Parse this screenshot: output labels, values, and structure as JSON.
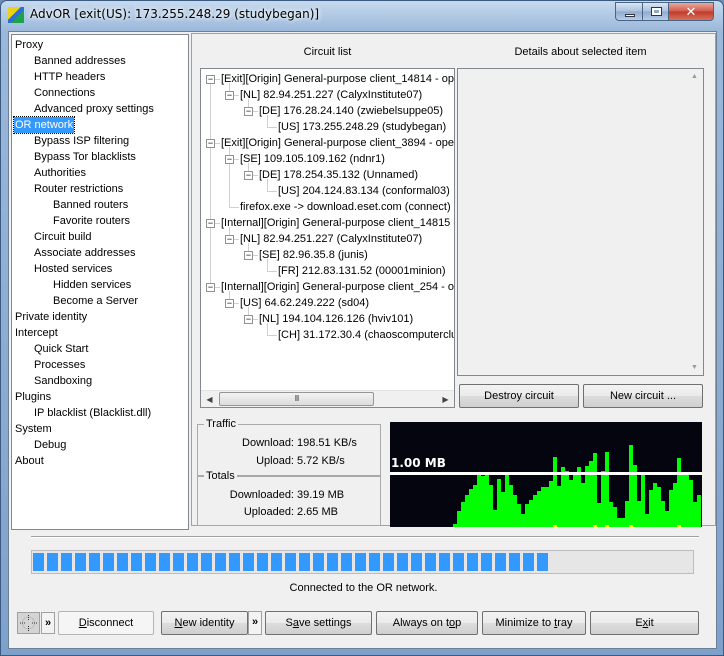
{
  "window": {
    "title": "AdvOR [exit(US): 173.255.248.29 (studybegan)]",
    "controls": {
      "minimize": "minimize",
      "maximize": "maximize",
      "close": "close"
    }
  },
  "nav": {
    "items": [
      {
        "label": "Proxy",
        "level": 0
      },
      {
        "label": "Banned addresses",
        "level": 1
      },
      {
        "label": "HTTP headers",
        "level": 1
      },
      {
        "label": "Connections",
        "level": 1
      },
      {
        "label": "Advanced proxy settings",
        "level": 1
      },
      {
        "label": "OR network",
        "level": 0,
        "selected": true
      },
      {
        "label": "Bypass ISP filtering",
        "level": 1
      },
      {
        "label": "Bypass Tor blacklists",
        "level": 1
      },
      {
        "label": "Authorities",
        "level": 1
      },
      {
        "label": "Router restrictions",
        "level": 1
      },
      {
        "label": "Banned routers",
        "level": 2
      },
      {
        "label": "Favorite routers",
        "level": 2
      },
      {
        "label": "Circuit build",
        "level": 1
      },
      {
        "label": "Associate addresses",
        "level": 1
      },
      {
        "label": "Hosted services",
        "level": 1
      },
      {
        "label": "Hidden services",
        "level": 2
      },
      {
        "label": "Become a Server",
        "level": 2
      },
      {
        "label": "Private identity",
        "level": 0
      },
      {
        "label": "Intercept",
        "level": 0
      },
      {
        "label": "Quick Start",
        "level": 1
      },
      {
        "label": "Processes",
        "level": 1
      },
      {
        "label": "Sandboxing",
        "level": 1
      },
      {
        "label": "Plugins",
        "level": 0
      },
      {
        "label": "IP blacklist (Blacklist.dll)",
        "level": 1
      },
      {
        "label": "System",
        "level": 0
      },
      {
        "label": "Debug",
        "level": 1
      },
      {
        "label": "About",
        "level": 0
      }
    ]
  },
  "circuits": {
    "header": "Circuit list",
    "rows": [
      {
        "label": "[Exit][Origin] General-purpose client_14814 - ope",
        "level": 0,
        "expander": "minus"
      },
      {
        "label": "[NL] 82.94.251.227 (CalyxInstitute07)",
        "level": 1,
        "expander": "minus"
      },
      {
        "label": "[DE] 176.28.24.140 (zwiebelsuppe05)",
        "level": 2,
        "expander": "minus"
      },
      {
        "label": "[US] 173.255.248.29 (studybegan)",
        "level": 3,
        "expander": "none"
      },
      {
        "label": "[Exit][Origin] General-purpose client_3894 - oper",
        "level": 0,
        "expander": "minus"
      },
      {
        "label": "[SE] 109.105.109.162 (ndnr1)",
        "level": 1,
        "expander": "minus"
      },
      {
        "label": "[DE] 178.254.35.132 (Unnamed)",
        "level": 2,
        "expander": "minus"
      },
      {
        "label": "[US] 204.124.83.134 (conformal03)",
        "level": 3,
        "expander": "none"
      },
      {
        "label": "firefox.exe -> download.eset.com (connect)",
        "level": 1,
        "expander": "none"
      },
      {
        "label": "[Internal][Origin] General-purpose client_14815 -",
        "level": 0,
        "expander": "minus"
      },
      {
        "label": "[NL] 82.94.251.227 (CalyxInstitute07)",
        "level": 1,
        "expander": "minus"
      },
      {
        "label": "[SE] 82.96.35.8 (junis)",
        "level": 2,
        "expander": "minus"
      },
      {
        "label": "[FR] 212.83.131.52 (00001minion)",
        "level": 3,
        "expander": "none"
      },
      {
        "label": "[Internal][Origin] General-purpose client_254 - op",
        "level": 0,
        "expander": "minus"
      },
      {
        "label": "[US] 64.62.249.222 (sd04)",
        "level": 1,
        "expander": "minus"
      },
      {
        "label": "[NL] 194.104.126.126 (hviv101)",
        "level": 2,
        "expander": "minus"
      },
      {
        "label": "[CH] 31.172.30.4 (chaoscomputerclu",
        "level": 3,
        "expander": "none"
      }
    ],
    "scroll_thumb": "III"
  },
  "details": {
    "header": "Details about selected item",
    "text": ""
  },
  "buttons": {
    "destroy_circuit": "Destroy circuit",
    "new_circuit": "New circuit ...",
    "disconnect": {
      "pre": "",
      "u": "D",
      "post": "isconnect"
    },
    "new_identity": {
      "pre": "",
      "u": "N",
      "post": "ew identity"
    },
    "save_settings": {
      "pre": "S",
      "u": "a",
      "post": "ve settings"
    },
    "always_on_top": {
      "pre": "Always on t",
      "u": "o",
      "post": "p"
    },
    "minimize_to_tray": {
      "pre": "Minimize to ",
      "u": "t",
      "post": "ray"
    },
    "exit": {
      "pre": "E",
      "u": "x",
      "post": "it"
    },
    "more": "»"
  },
  "traffic": {
    "title": "Traffic",
    "download_label": "Download:",
    "download_value": "198.51 KB/s",
    "upload_label": "Upload:",
    "upload_value": "5.72 KB/s"
  },
  "totals": {
    "title": "Totals",
    "downloaded_label": "Downloaded:",
    "downloaded_value": "39.19 MB",
    "uploaded_label": "Uploaded:",
    "uploaded_value": "2.65 MB"
  },
  "graph": {
    "scale_label": "1.00 MB",
    "scale_value_mb": 1.0,
    "max_mb": 1.98,
    "colors": {
      "download": "#00ff00",
      "upload": "#ffff00",
      "background": "#050510",
      "scale_line": "#ffffff"
    },
    "download_mb": [
      0.05,
      0.3,
      0.47,
      0.6,
      0.72,
      0.8,
      0.99,
      0.96,
      0.99,
      0.8,
      0.33,
      0.92,
      0.66,
      0.99,
      0.8,
      0.6,
      0.44,
      0.25,
      0.44,
      0.52,
      0.6,
      0.68,
      0.75,
      0.75,
      0.88,
      1.33,
      0.78,
      1.14,
      1.06,
      0.9,
      0.99,
      1.13,
      0.84,
      1.16,
      1.25,
      1.4,
      0.45,
      1.06,
      1.43,
      0.47,
      0.38,
      0.18,
      0.18,
      0.5,
      1.55,
      1.18,
      0.5,
      0.99,
      0.25,
      0.7,
      0.83,
      0.75,
      0.5,
      0.3,
      0.7,
      0.83,
      1.3,
      1.0,
      0.99,
      0.9,
      0.47,
      0.6
    ],
    "upload_mb": [
      0,
      0,
      0,
      0,
      0,
      0,
      0,
      0,
      0,
      0,
      0,
      0,
      0,
      0,
      0,
      0,
      0,
      0,
      0,
      0,
      0,
      0,
      0,
      0,
      0,
      0.04,
      0,
      0,
      0,
      0,
      0,
      0,
      0,
      0,
      0,
      0.04,
      0,
      0,
      0.04,
      0,
      0,
      0,
      0,
      0,
      0.04,
      0,
      0,
      0,
      0,
      0,
      0,
      0,
      0,
      0,
      0,
      0,
      0.04,
      0,
      0,
      0,
      0,
      0
    ]
  },
  "progress": {
    "segments": 37,
    "filled_fraction": 1.0
  },
  "status": "Connected to the OR network."
}
